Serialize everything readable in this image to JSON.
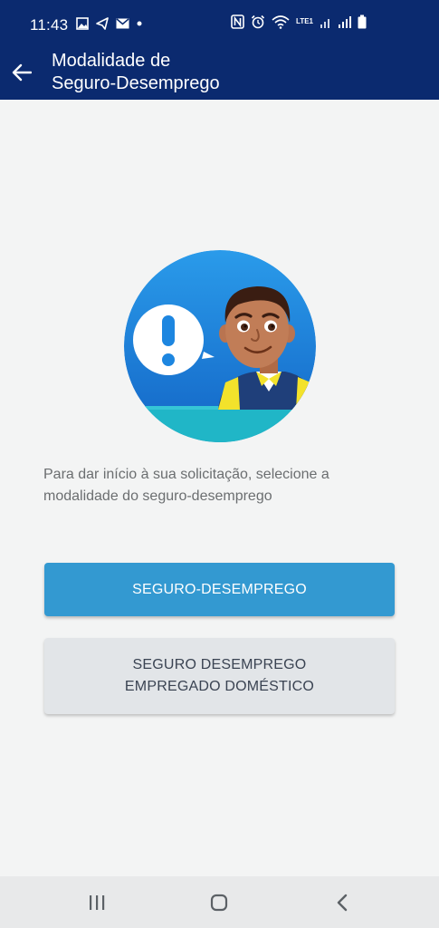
{
  "status_bar": {
    "time": "11:43",
    "network_label": "LTE1"
  },
  "app_bar": {
    "title": "Modalidade de\nSeguro-Desemprego",
    "back_icon": "arrow-left-icon"
  },
  "main": {
    "illustration": "agent-with-exclamation-bubble",
    "instruction": "Para dar início à sua solicitação, selecione a modalidade do seguro-desemprego",
    "buttons": {
      "primary_label": "SEGURO-DESEMPREGO",
      "secondary_label": "SEGURO DESEMPREGO\nEMPREGADO DOMÉSTICO"
    }
  },
  "nav_bar": {
    "recent_icon": "recent-apps-icon",
    "home_icon": "home-icon",
    "back_icon": "back-icon"
  },
  "colors": {
    "header": "#0b2a6f",
    "primary_button": "#3399d1",
    "secondary_button": "#e2e5e8",
    "background": "#f3f4f4"
  }
}
